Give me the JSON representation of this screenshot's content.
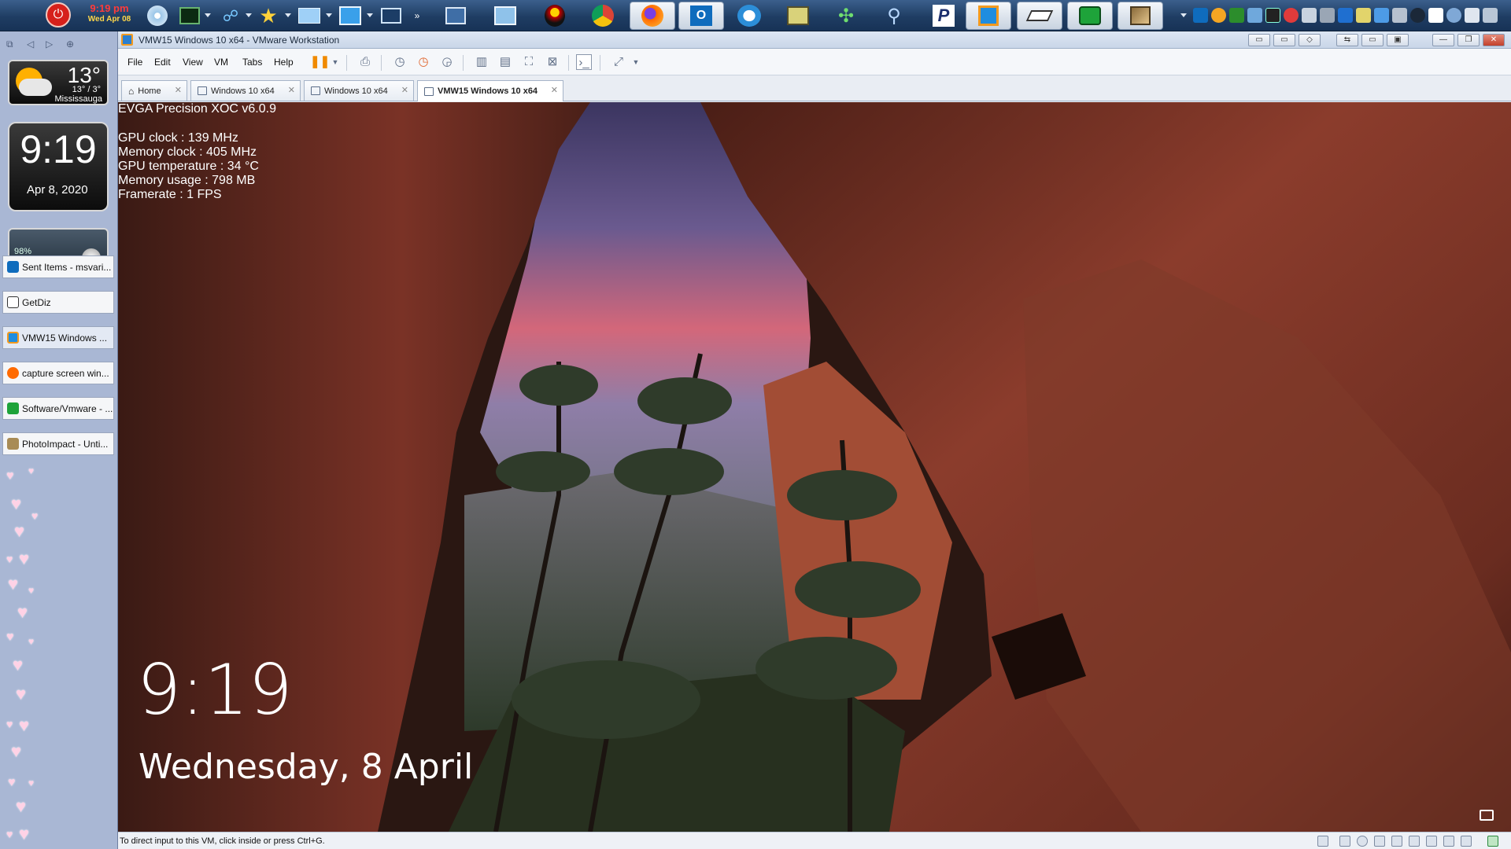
{
  "taskbar": {
    "clock_time": "9:19 pm",
    "clock_date": "Wed Apr 08"
  },
  "sidebar": {
    "weather": {
      "temp": "13°",
      "range": "13° / 3°",
      "city": "Mississauga"
    },
    "clock": {
      "time": "9:19",
      "date": "Apr 8, 2020"
    },
    "meter": {
      "percent": "98%"
    },
    "tasks": [
      {
        "label": "Sent Items - msvari..."
      },
      {
        "label": "GetDiz"
      },
      {
        "label": "VMW15 Windows ..."
      },
      {
        "label": "capture screen win..."
      },
      {
        "label": "Software/Vmware - ..."
      },
      {
        "label": "PhotoImpact - Unti..."
      }
    ]
  },
  "window": {
    "title": "VMW15 Windows 10 x64 - VMware Workstation",
    "menu": [
      "File",
      "Edit",
      "View",
      "VM",
      "Tabs",
      "Help"
    ],
    "tabs": [
      {
        "label": "Home"
      },
      {
        "label": "Windows 10 x64"
      },
      {
        "label": "Windows 10 x64"
      },
      {
        "label": "VMW15 Windows 10 x64"
      }
    ],
    "status_message": "To direct input to this VM, click inside or press Ctrl+G."
  },
  "vm": {
    "osd": {
      "title": "EVGA Precision XOC  v6.0.9",
      "lines": [
        "GPU clock : 139 MHz",
        "Memory clock : 405 MHz",
        "GPU temperature : 34 °C",
        "Memory usage : 798 MB",
        "Framerate : 1 FPS"
      ]
    },
    "lock_time": "9:19",
    "lock_date": "Wednesday, 8 April"
  }
}
